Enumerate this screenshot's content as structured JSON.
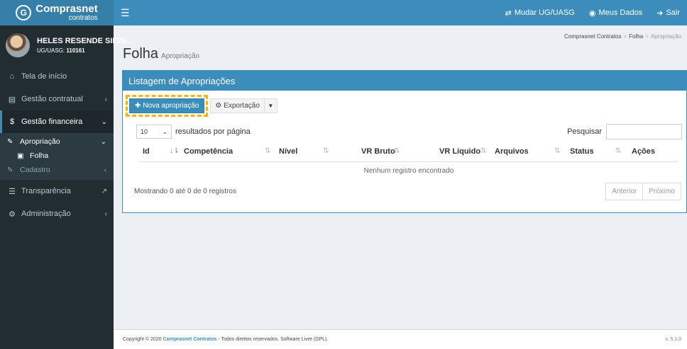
{
  "brand": {
    "name": "Comprasnet",
    "sub": "contratos"
  },
  "topbar": {
    "menu_icon": "bars-icon",
    "links": [
      {
        "icon": "exchange-icon",
        "glyph": "⇄",
        "label": "Mudar UG/UASG"
      },
      {
        "icon": "user-circle-icon",
        "glyph": "◉",
        "label": "Meus Dados"
      },
      {
        "icon": "sign-out-icon",
        "glyph": "➜",
        "label": "Sair"
      }
    ]
  },
  "user": {
    "name": "HELES RESENDE SILVA...",
    "ug_label": "UG/UASG:",
    "ug_code": "110161"
  },
  "sidebar": {
    "home": "Tela de início",
    "contratual": "Gestão contratual",
    "financeira": "Gestão financeira",
    "apropriacao": "Apropriação",
    "folha": "Folha",
    "cadastro": "Cadastro",
    "transparencia": "Transparência",
    "administracao": "Administração"
  },
  "breadcrumb": {
    "root": "Comprasnet Contratos",
    "mid": "Folha",
    "current": "Apropriação"
  },
  "page": {
    "title": "Folha",
    "subtitle": "Apropriação"
  },
  "box": {
    "title": "Listagem de Apropriações",
    "new_button": "Nova apropriação",
    "export_button": "Exportação",
    "page_length": "10",
    "length_label": "resultados por página",
    "search_label": "Pesquisar",
    "search_placeholder": "",
    "columns": [
      "Id",
      "Competência",
      "Nível",
      "VR Bruto",
      "VR Líquido",
      "Arquivos",
      "Status",
      "Ações"
    ],
    "empty": "Nenhum registro encontrado",
    "info": "Mostrando 0 até 0 de 0 registros",
    "prev": "Anterior",
    "next": "Próximo"
  },
  "footer": {
    "prefix": "Copyright © 2020",
    "brand": "Comprasnet Contratos",
    "suffix": "- Todos direitos reservados. Software Livre (GPL).",
    "version": "v. 5.1.0"
  }
}
